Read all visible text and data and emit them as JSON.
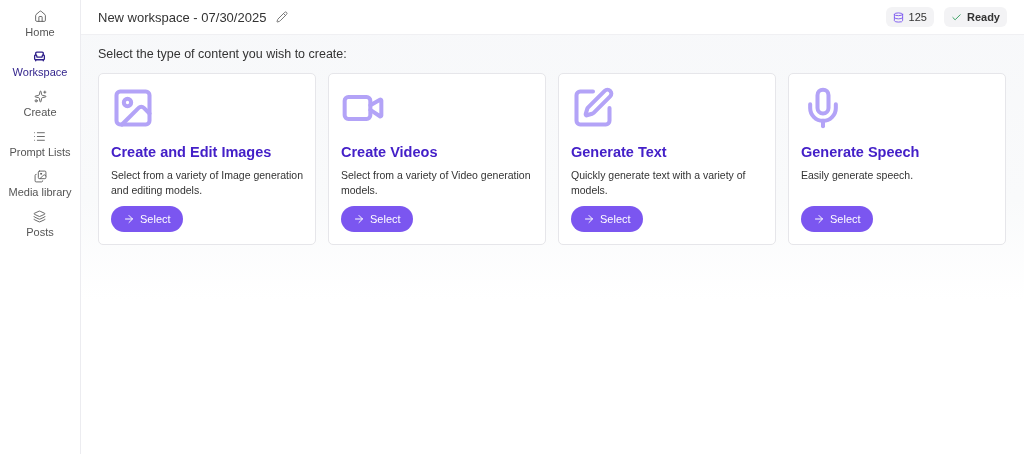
{
  "sidebar": {
    "items": [
      {
        "label": "Home",
        "selected": false
      },
      {
        "label": "Workspace",
        "selected": true
      },
      {
        "label": "Create",
        "selected": false
      },
      {
        "label": "Prompt Lists",
        "selected": false
      },
      {
        "label": "Media library",
        "selected": false
      },
      {
        "label": "Posts",
        "selected": false
      }
    ]
  },
  "header": {
    "title": "New workspace - 07/30/2025",
    "credits": "125",
    "status": "Ready"
  },
  "prompt": "Select the type of content you wish to create:",
  "cards": [
    {
      "title": "Create and Edit Images",
      "description": "Select from a variety of Image generation and editing models.",
      "button": "Select"
    },
    {
      "title": "Create Videos",
      "description": "Select from a variety of Video generation models.",
      "button": "Select"
    },
    {
      "title": "Generate Text",
      "description": "Quickly generate text with a variety of models.",
      "button": "Select"
    },
    {
      "title": "Generate Speech",
      "description": "Easily generate speech.",
      "button": "Select"
    }
  ]
}
